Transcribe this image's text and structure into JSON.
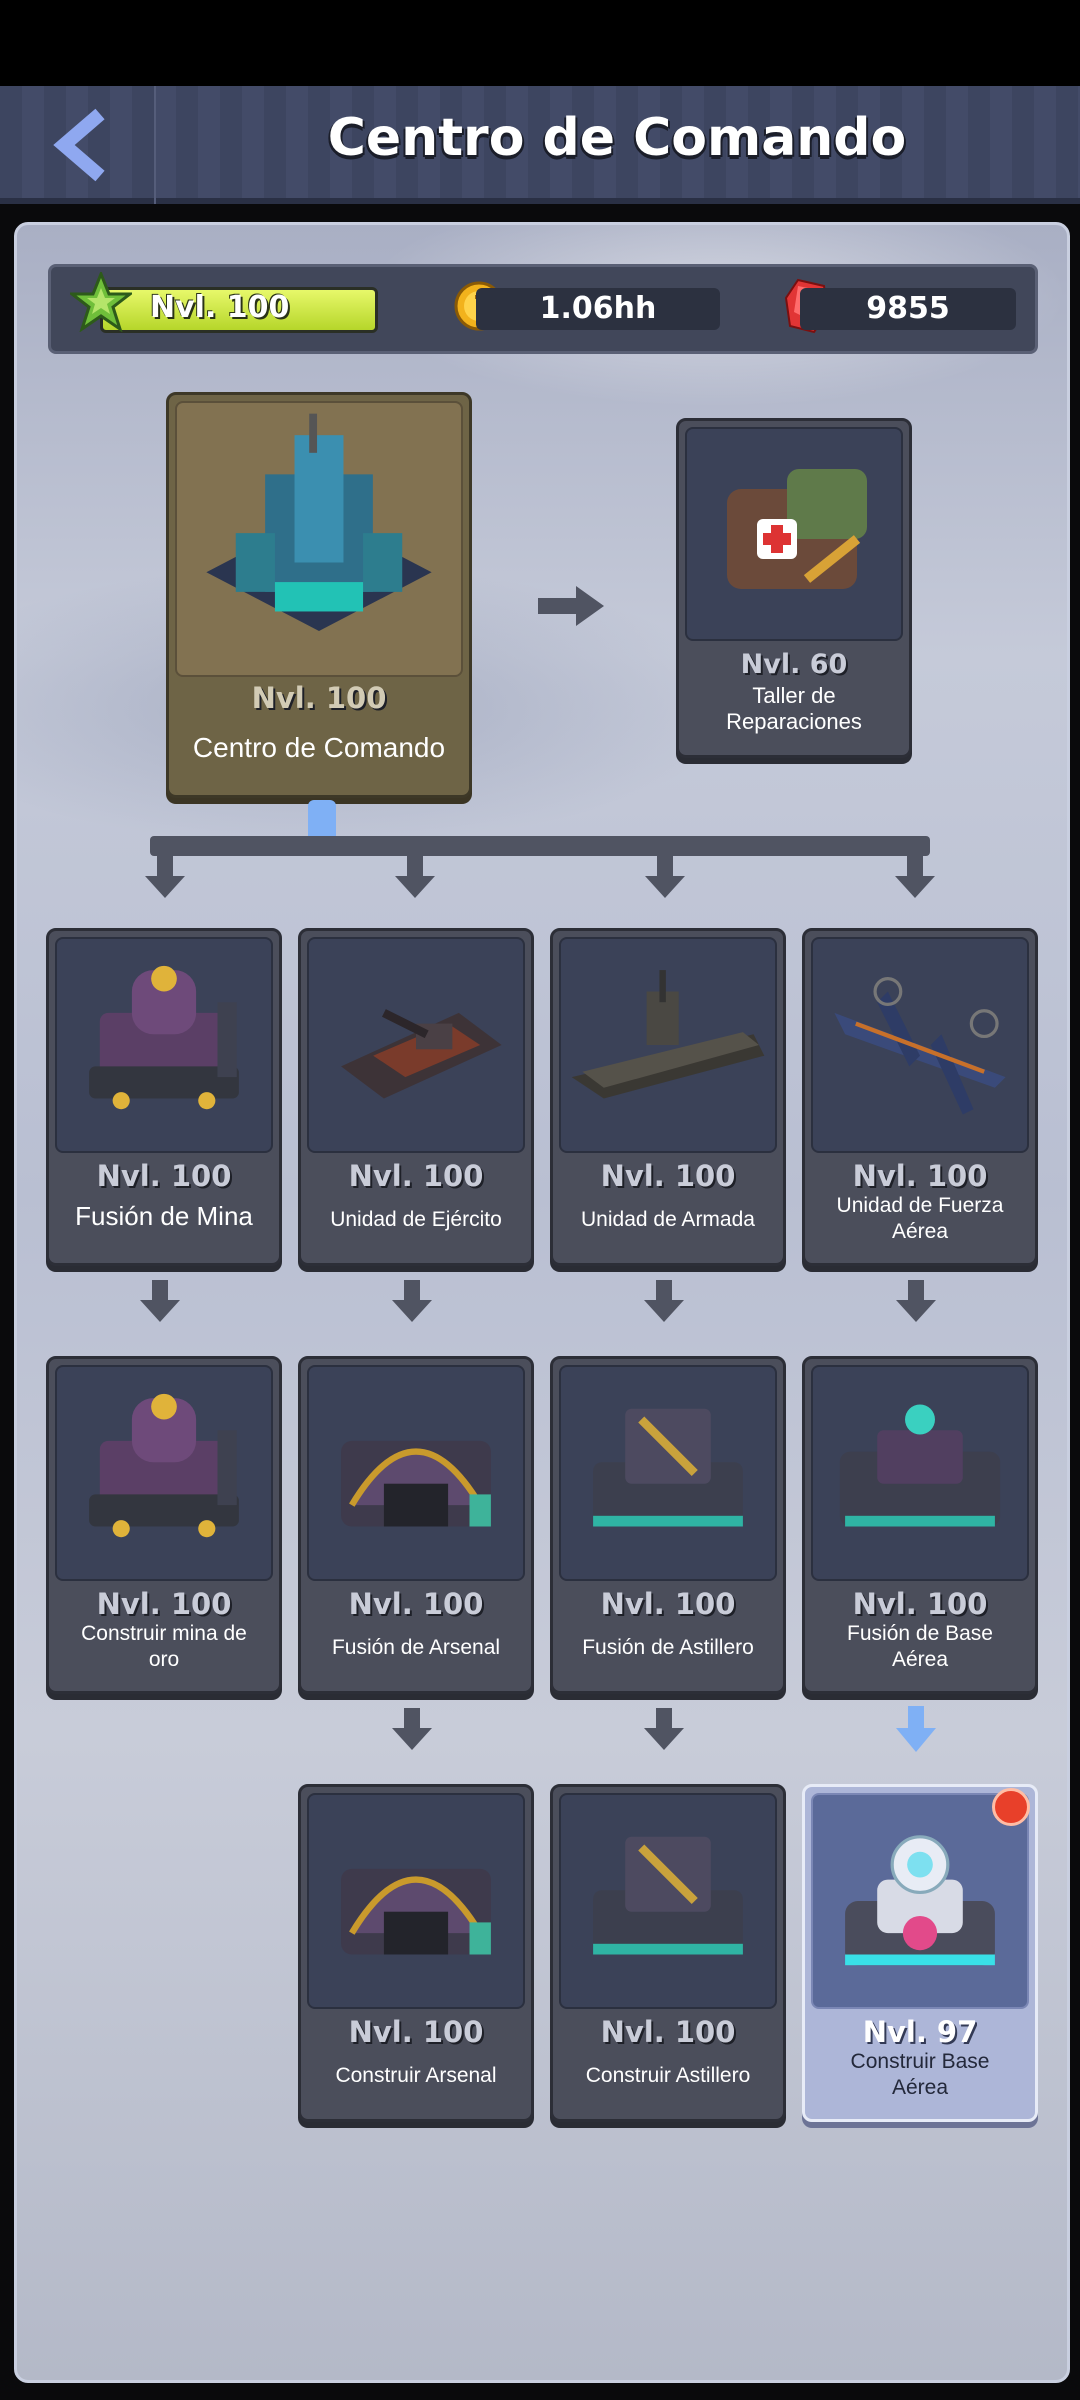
{
  "header": {
    "title": "Centro de Comando"
  },
  "resources": {
    "level": "Nvl. 100",
    "gold": "1.06hh",
    "gems": "9855"
  },
  "colors": {
    "level_bar": "#c9e545",
    "gem": "#e83a3a",
    "highlight": "#adb6d8",
    "notify": "#e8402a"
  },
  "main": {
    "level": "Nvl. 100",
    "name": "Centro de Comando"
  },
  "side": {
    "level": "Nvl. 60",
    "name_line1": "Taller de",
    "name_line2": "Reparaciones"
  },
  "row1": [
    {
      "level": "Nvl. 100",
      "name": "Fusión de Mina"
    },
    {
      "level": "Nvl. 100",
      "name": "Unidad de Ejército"
    },
    {
      "level": "Nvl. 100",
      "name": "Unidad de Armada"
    },
    {
      "level": "Nvl. 100",
      "name_line1": "Unidad de Fuerza",
      "name_line2": "Aérea"
    }
  ],
  "row2": [
    {
      "level": "Nvl. 100",
      "name_line1": "Construir mina de",
      "name_line2": "oro"
    },
    {
      "level": "Nvl. 100",
      "name": "Fusión de Arsenal"
    },
    {
      "level": "Nvl. 100",
      "name": "Fusión de Astillero"
    },
    {
      "level": "Nvl. 100",
      "name_line1": "Fusión de Base",
      "name_line2": "Aérea"
    }
  ],
  "row3": [
    {
      "level": "Nvl. 100",
      "name": "Construir Arsenal"
    },
    {
      "level": "Nvl. 100",
      "name": "Construir Astillero"
    },
    {
      "level": "Nvl. 97",
      "name_line1": "Construir Base",
      "name_line2": "Aérea"
    }
  ]
}
